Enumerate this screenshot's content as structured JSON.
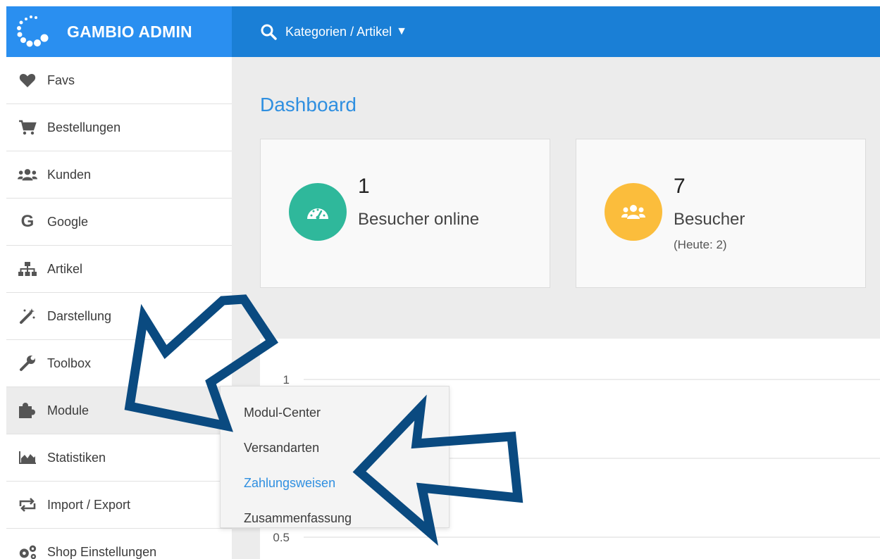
{
  "app": {
    "brand": "GAMBIO ADMIN"
  },
  "search": {
    "label": "Kategorien / Artikel",
    "caret": "▼"
  },
  "sidebar": {
    "items": [
      {
        "label": "Favs",
        "icon": "heart-icon"
      },
      {
        "label": "Bestellungen",
        "icon": "cart-icon"
      },
      {
        "label": "Kunden",
        "icon": "users-icon"
      },
      {
        "label": "Google",
        "icon": "google-icon"
      },
      {
        "label": "Artikel",
        "icon": "sitemap-icon"
      },
      {
        "label": "Darstellung",
        "icon": "magic-wand-icon"
      },
      {
        "label": "Toolbox",
        "icon": "wrench-icon"
      },
      {
        "label": "Module",
        "icon": "puzzle-icon",
        "active": true
      },
      {
        "label": "Statistiken",
        "icon": "area-chart-icon"
      },
      {
        "label": "Import / Export",
        "icon": "exchange-icon"
      },
      {
        "label": "Shop Einstellungen",
        "icon": "gears-icon"
      }
    ]
  },
  "dashboard": {
    "title": "Dashboard",
    "cards": [
      {
        "value": "1",
        "label": "Besucher online",
        "icon": "gauge-icon",
        "color": "#2fb89b"
      },
      {
        "value": "7",
        "label": "Besucher",
        "sub": "(Heute: 2)",
        "icon": "users-icon",
        "color": "#fbbd3c"
      }
    ]
  },
  "module_menu": {
    "items": [
      "Modul-Center",
      "Versandarten",
      "Zahlungsweisen",
      "Zusammenfassung"
    ],
    "highlighted": "Zahlungsweisen"
  },
  "chart_data": {
    "type": "line",
    "yticks": [
      "1",
      "0.5"
    ],
    "ylim": [
      0.5,
      1
    ],
    "grid": true
  },
  "colors": {
    "topbar": "#1a7fd6",
    "brand": "#2a8ff0",
    "accent": "#2f8fe0",
    "arrow": "#0a4a80"
  }
}
